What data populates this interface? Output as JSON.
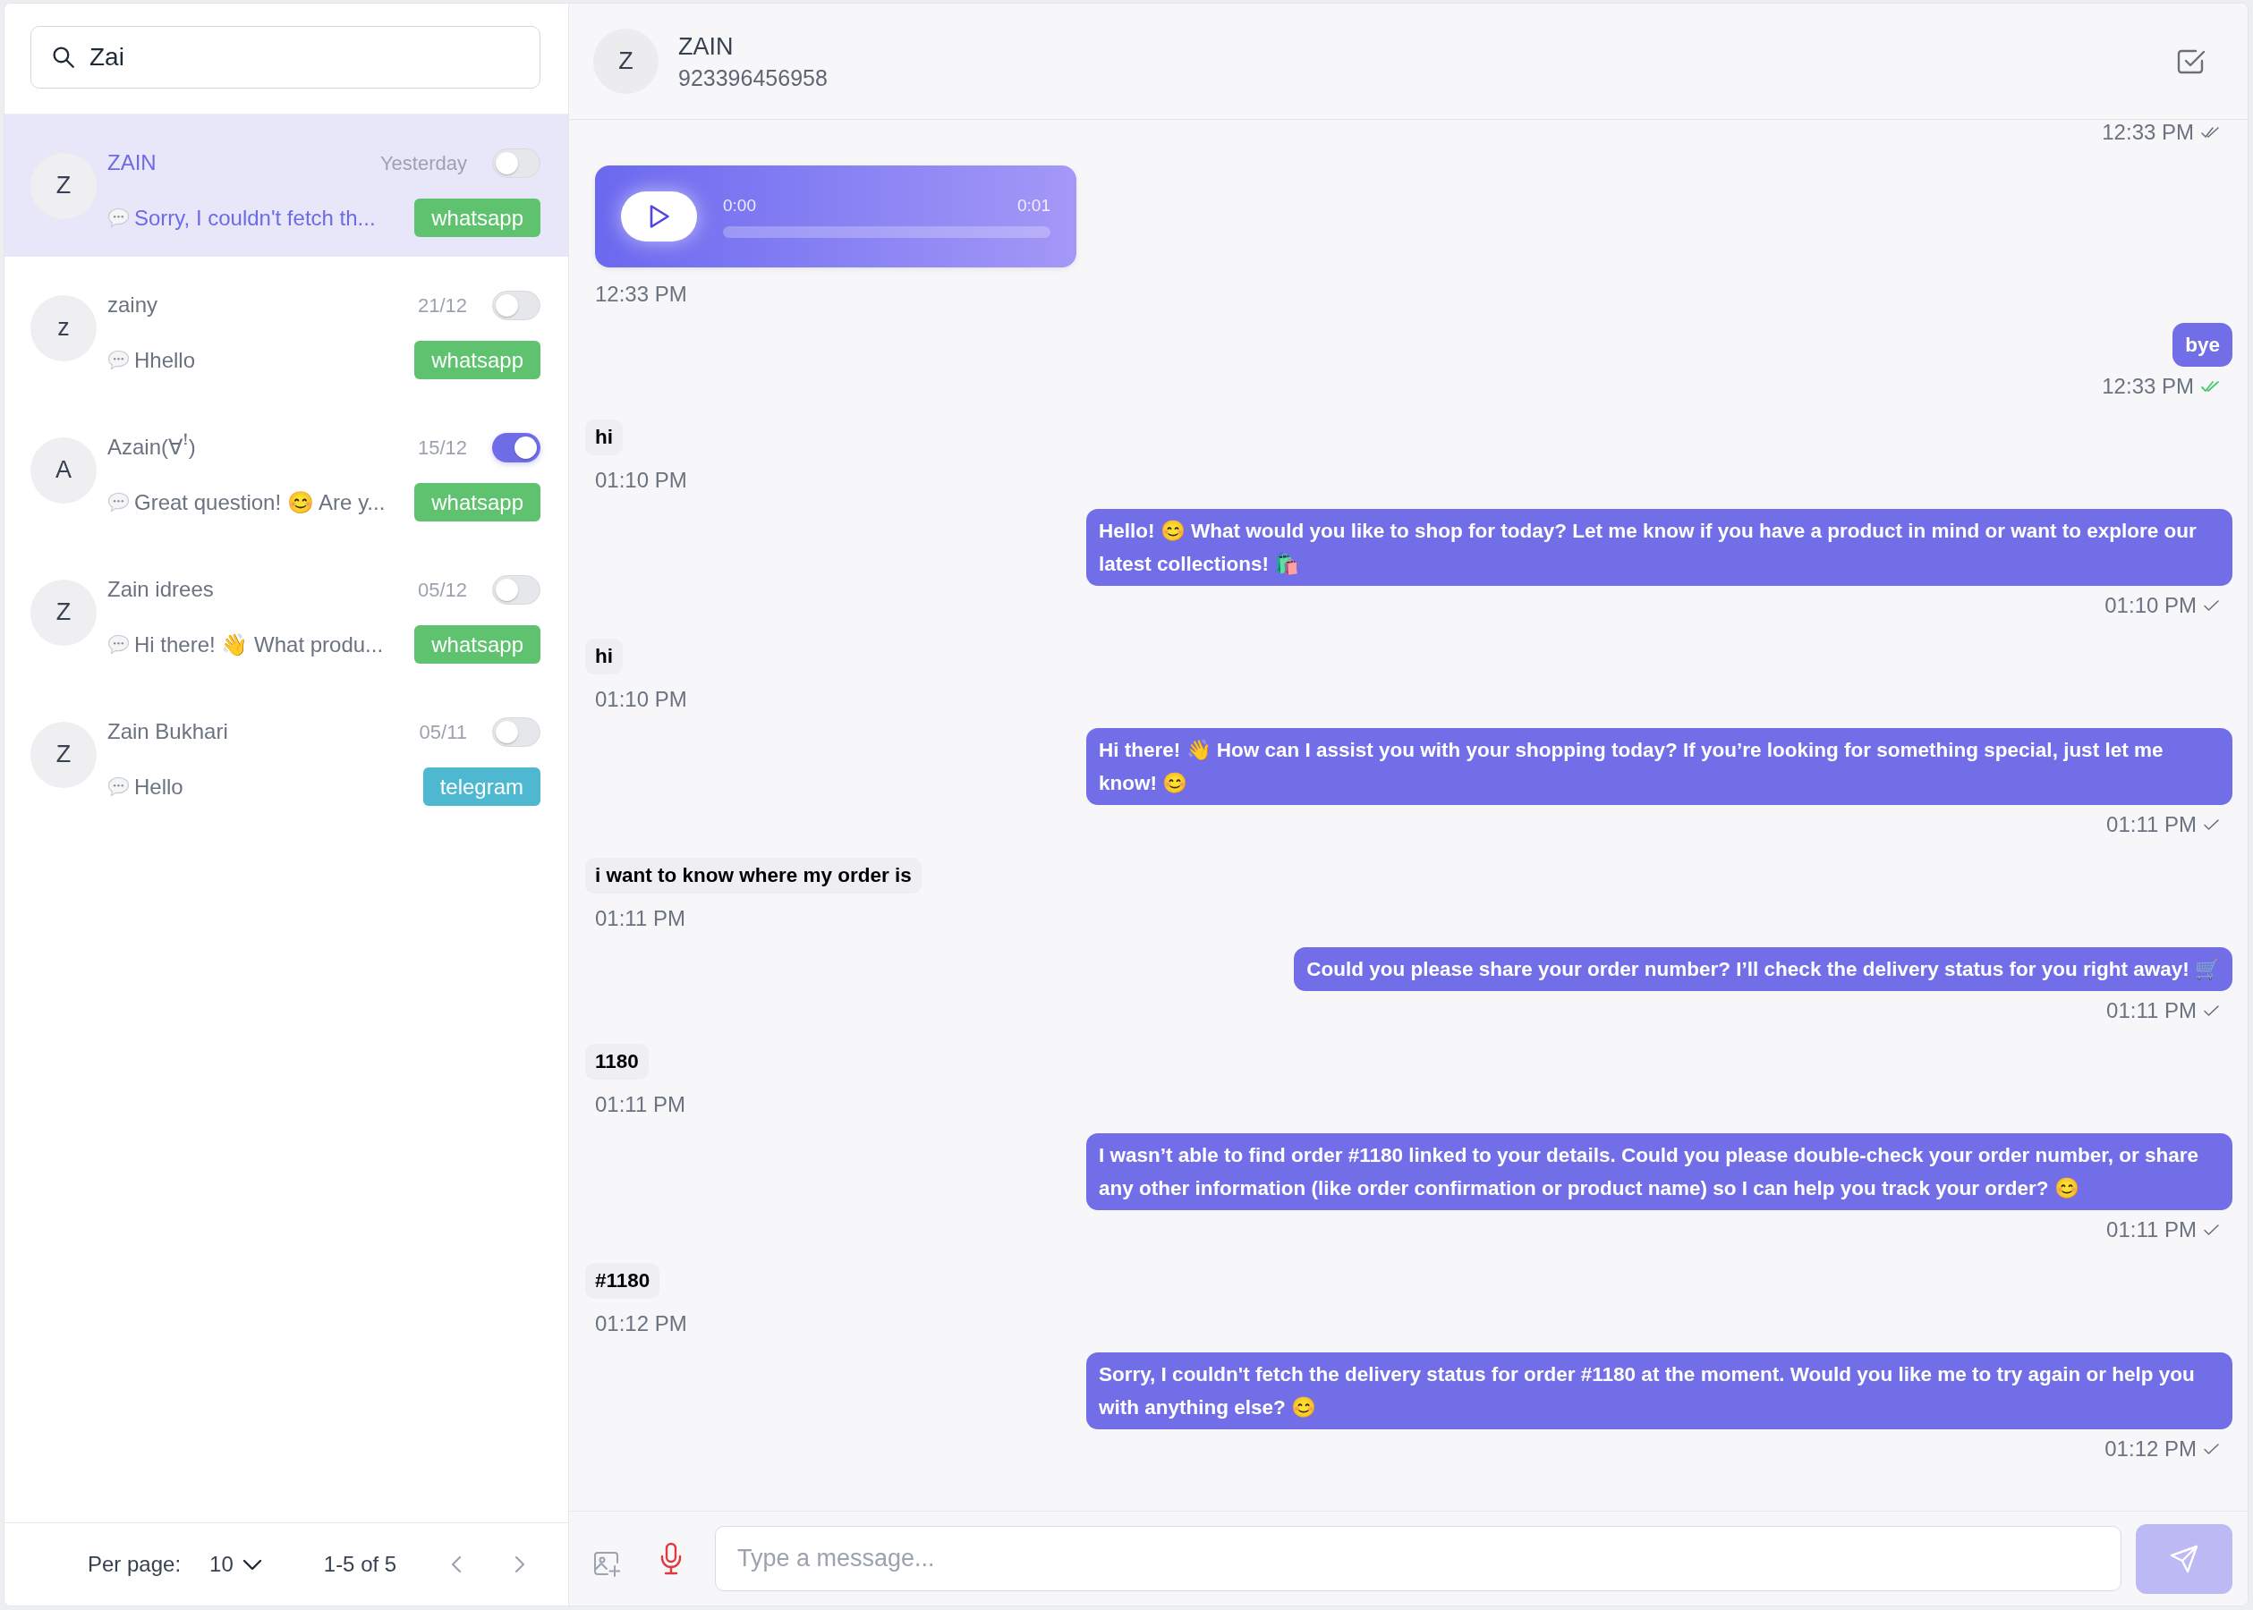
{
  "sidebar": {
    "search": {
      "value": "Zai"
    },
    "conversations": [
      {
        "avatar": "Z",
        "name": "ZAIN",
        "date": "Yesterday",
        "on": false,
        "preview": "Sorry, I couldn't fetch th...",
        "channel": {
          "label": "whatsapp",
          "color": "#5ec26f"
        },
        "selected": true
      },
      {
        "avatar": "z",
        "name": "zainy",
        "date": "21/12",
        "on": false,
        "preview": "Hhello",
        "channel": {
          "label": "whatsapp",
          "color": "#5ec26f"
        },
        "selected": false
      },
      {
        "avatar": "A",
        "name": "Azain(∀ꜝ)",
        "date": "15/12",
        "on": true,
        "preview": "Great question! 😊 Are y...",
        "channel": {
          "label": "whatsapp",
          "color": "#5ec26f"
        },
        "selected": false
      },
      {
        "avatar": "Z",
        "name": "Zain idrees",
        "date": "05/12",
        "on": false,
        "preview": "Hi there! 👋 What produ...",
        "channel": {
          "label": "whatsapp",
          "color": "#5ec26f"
        },
        "selected": false
      },
      {
        "avatar": "Z",
        "name": "Zain Bukhari",
        "date": "05/11",
        "on": false,
        "preview": "Hello",
        "channel": {
          "label": "telegram",
          "color": "#4fb8d1"
        },
        "selected": false
      }
    ],
    "pagination": {
      "per_page_label": "Per page:",
      "per_page": "10",
      "range": "1-5 of 5"
    }
  },
  "chat": {
    "contact": {
      "avatar": "Z",
      "name": "ZAIN",
      "phone": "923396456958"
    },
    "messages": [
      {
        "kind": "timestamp",
        "outgoing": true,
        "time": "12:33 PM",
        "delivered": true,
        "read": false
      },
      {
        "kind": "audio",
        "outgoing": false,
        "position": "0:00",
        "duration": "0:01",
        "time": "12:33 PM"
      },
      {
        "kind": "text",
        "outgoing": true,
        "text": "bye",
        "time": "12:33 PM",
        "delivered": true,
        "read": true
      },
      {
        "kind": "text",
        "outgoing": false,
        "text": "hi",
        "time": "01:10 PM"
      },
      {
        "kind": "text",
        "outgoing": true,
        "text": "Hello! 😊 What would you like to shop for today? Let me know if you have a product in mind or want to explore our latest collections! 🛍️",
        "time": "01:10 PM",
        "delivered": false,
        "read": false
      },
      {
        "kind": "text",
        "outgoing": false,
        "text": "hi",
        "time": "01:10 PM"
      },
      {
        "kind": "text",
        "outgoing": true,
        "text": "Hi there! 👋 How can I assist you with your shopping today? If you’re looking for something special, just let me know! 😊",
        "time": "01:11 PM",
        "delivered": false,
        "read": false
      },
      {
        "kind": "text",
        "outgoing": false,
        "text": "i want to know where my order is",
        "time": "01:11 PM"
      },
      {
        "kind": "text",
        "outgoing": true,
        "text": "Could you please share your order number? I’ll check the delivery status for you right away! 🛒",
        "time": "01:11 PM",
        "delivered": false,
        "read": false
      },
      {
        "kind": "text",
        "outgoing": false,
        "text": "1180",
        "time": "01:11 PM"
      },
      {
        "kind": "text",
        "outgoing": true,
        "text": "I wasn’t able to find order #1180 linked to your details. Could you please double-check your order number, or share any other information (like order confirmation or product name) so I can help you track your order? 😊",
        "time": "01:11 PM",
        "delivered": false,
        "read": false
      },
      {
        "kind": "text",
        "outgoing": false,
        "text": "#1180",
        "time": "01:12 PM"
      },
      {
        "kind": "text",
        "outgoing": true,
        "text": "Sorry, I couldn't fetch the delivery status for order #1180 at the moment. Would you like me to try again or help you with anything else? 😊",
        "time": "01:12 PM",
        "delivered": false,
        "read": false
      }
    ],
    "composer": {
      "placeholder": "Type a message...",
      "send_disabled": true
    }
  }
}
